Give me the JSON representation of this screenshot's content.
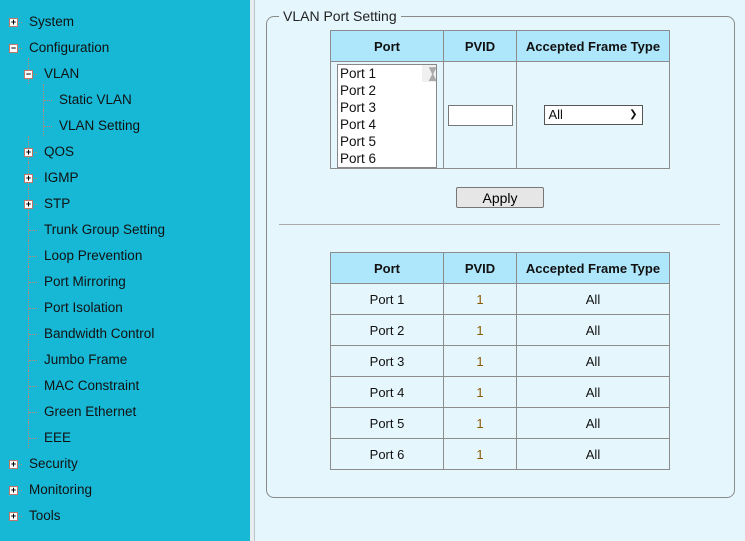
{
  "sidebar": {
    "items": [
      {
        "label": "System",
        "toggle": "+"
      },
      {
        "label": "Configuration",
        "toggle": "−"
      },
      {
        "label": "VLAN",
        "toggle": "−"
      },
      {
        "label": "Static VLAN"
      },
      {
        "label": "VLAN Setting"
      },
      {
        "label": "QOS",
        "toggle": "+"
      },
      {
        "label": "IGMP",
        "toggle": "+"
      },
      {
        "label": "STP",
        "toggle": "+"
      },
      {
        "label": "Trunk Group Setting"
      },
      {
        "label": "Loop Prevention"
      },
      {
        "label": "Port Mirroring"
      },
      {
        "label": "Port Isolation"
      },
      {
        "label": "Bandwidth Control"
      },
      {
        "label": "Jumbo Frame"
      },
      {
        "label": "MAC Constraint"
      },
      {
        "label": "Green Ethernet"
      },
      {
        "label": "EEE"
      },
      {
        "label": "Security",
        "toggle": "+"
      },
      {
        "label": "Monitoring",
        "toggle": "+"
      },
      {
        "label": "Tools",
        "toggle": "+"
      }
    ]
  },
  "main": {
    "legend": "VLAN Port Setting",
    "headers": [
      "Port",
      "PVID",
      "Accepted Frame Type"
    ],
    "port_list": [
      "Port 1",
      "Port 2",
      "Port 3",
      "Port 4",
      "Port 5",
      "Port 6"
    ],
    "pvid_value": "",
    "frame_type_selected": "All",
    "apply_label": "Apply",
    "rows": [
      {
        "port": "Port 1",
        "pvid": "1",
        "type": "All"
      },
      {
        "port": "Port 2",
        "pvid": "1",
        "type": "All"
      },
      {
        "port": "Port 3",
        "pvid": "1",
        "type": "All"
      },
      {
        "port": "Port 4",
        "pvid": "1",
        "type": "All"
      },
      {
        "port": "Port 5",
        "pvid": "1",
        "type": "All"
      },
      {
        "port": "Port 6",
        "pvid": "1",
        "type": "All"
      }
    ]
  },
  "colors": {
    "sidebar": "#17b8d6",
    "panel": "#e5f6fd",
    "header": "#aee6fb",
    "pvid_text": "#8a5a00"
  }
}
